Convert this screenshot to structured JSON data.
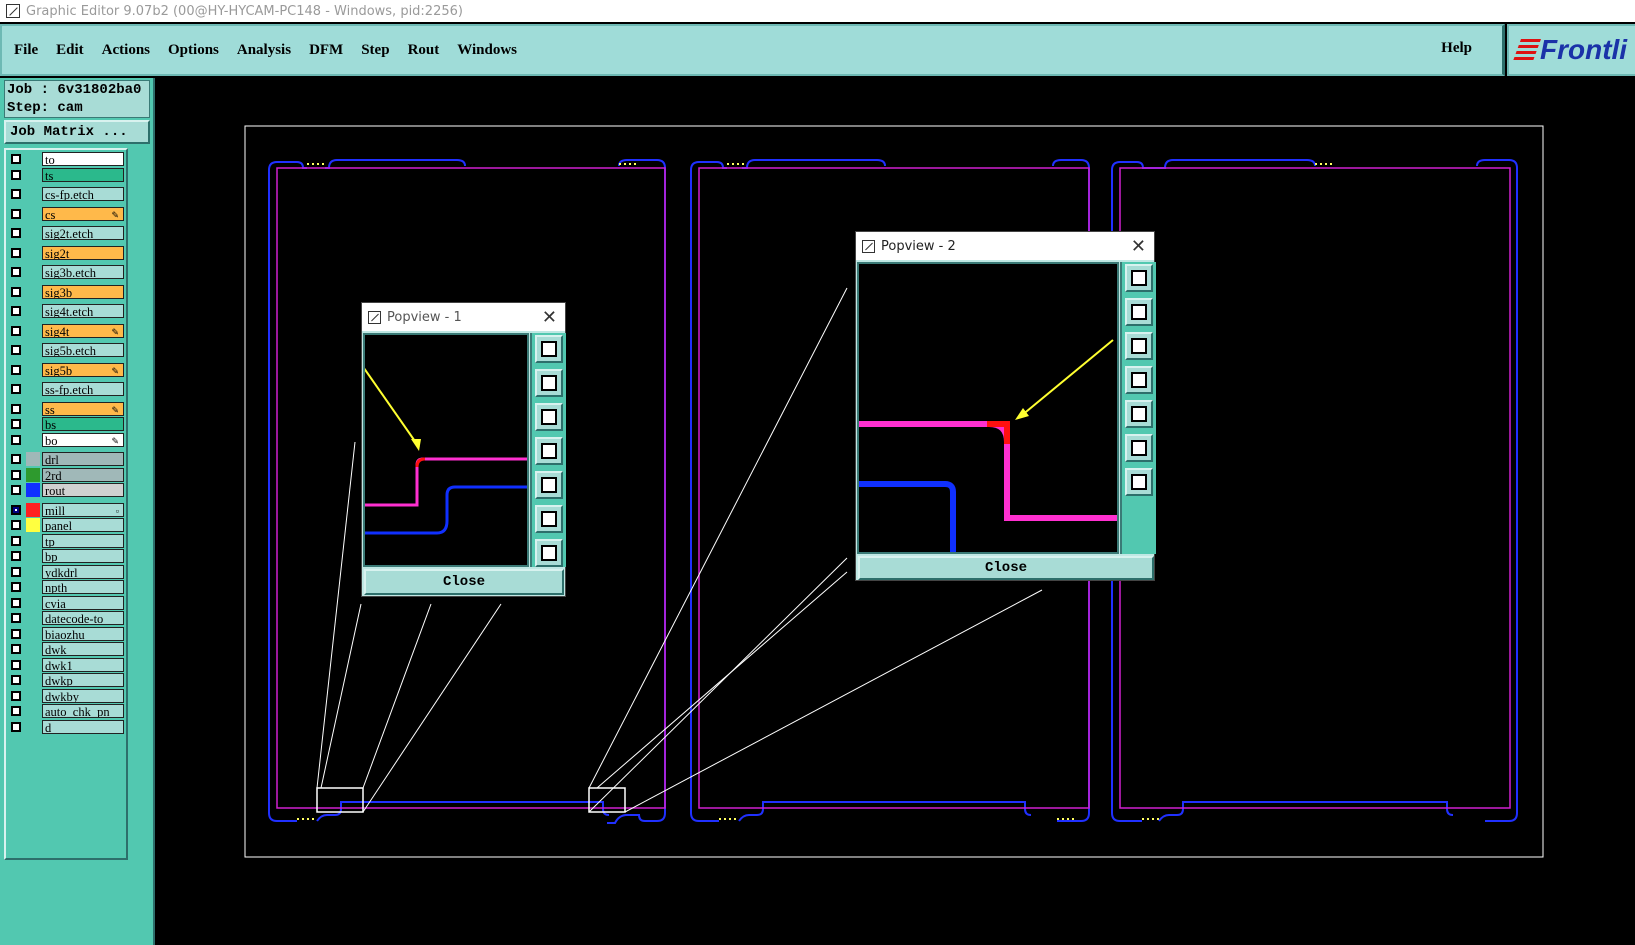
{
  "window": {
    "title": "Graphic Editor 9.07b2 (00@HY-HYCAM-PC148 - Windows, pid:2256)"
  },
  "menu": {
    "items": [
      "File",
      "Edit",
      "Actions",
      "Options",
      "Analysis",
      "DFM",
      "Step",
      "Rout",
      "Windows"
    ],
    "help": "Help",
    "logo": "Frontli"
  },
  "job": {
    "job_line": "Job : 6v31802ba0",
    "step_line": "Step: cam",
    "matrix_button": "Job Matrix ..."
  },
  "layers": [
    {
      "name": "to",
      "color": "#ffffff",
      "checked": false,
      "flag": ""
    },
    {
      "name": "ts",
      "color": "#2bb98c",
      "checked": false,
      "flag": ""
    },
    {
      "name": "cs-fp.etch",
      "color": "#a8dcd6",
      "checked": false,
      "flag": ""
    },
    {
      "name": "cs",
      "color": "#ffb94a",
      "checked": false,
      "flag": "✎"
    },
    {
      "name": "sig2t.etch",
      "color": "#a8dcd6",
      "checked": false,
      "flag": ""
    },
    {
      "name": "sig2t",
      "color": "#ffb94a",
      "checked": false,
      "flag": ""
    },
    {
      "name": "sig3b.etch",
      "color": "#a8dcd6",
      "checked": false,
      "flag": ""
    },
    {
      "name": "sig3b",
      "color": "#ffb94a",
      "checked": false,
      "flag": ""
    },
    {
      "name": "sig4t.etch",
      "color": "#a8dcd6",
      "checked": false,
      "flag": ""
    },
    {
      "name": "sig4t",
      "color": "#ffb94a",
      "checked": false,
      "flag": "✎"
    },
    {
      "name": "sig5b.etch",
      "color": "#a8dcd6",
      "checked": false,
      "flag": ""
    },
    {
      "name": "sig5b",
      "color": "#ffb94a",
      "checked": false,
      "flag": "✎"
    },
    {
      "name": "ss-fp.etch",
      "color": "#a8dcd6",
      "checked": false,
      "flag": ""
    },
    {
      "name": "ss",
      "color": "#ffb94a",
      "checked": false,
      "flag": "✎"
    },
    {
      "name": "bs",
      "color": "#2bb98c",
      "checked": false,
      "flag": ""
    },
    {
      "name": "bo",
      "color": "#ffffff",
      "checked": false,
      "flag": "✎"
    },
    {
      "name": "drl",
      "color": "#a0b8b8",
      "checked": false,
      "flag": ""
    },
    {
      "name": "2rd",
      "color": "#a0b8b8",
      "checked": false,
      "flag": ""
    },
    {
      "name": "rout",
      "color": "#d0d0d0",
      "checked": false,
      "flag": ""
    },
    {
      "name": "mill",
      "color": "#a8dcd6",
      "checked": true,
      "flag": "▫"
    },
    {
      "name": "panel",
      "color": "#a8dcd6",
      "checked": false,
      "flag": ""
    },
    {
      "name": "tp",
      "color": "#a8dcd6",
      "checked": false,
      "flag": ""
    },
    {
      "name": "bp",
      "color": "#a8dcd6",
      "checked": false,
      "flag": ""
    },
    {
      "name": "ydkdrl",
      "color": "#a8dcd6",
      "checked": false,
      "flag": ""
    },
    {
      "name": "npth",
      "color": "#a8dcd6",
      "checked": false,
      "flag": ""
    },
    {
      "name": "cvia",
      "color": "#a8dcd6",
      "checked": false,
      "flag": ""
    },
    {
      "name": "datecode-to",
      "color": "#a8dcd6",
      "checked": false,
      "flag": ""
    },
    {
      "name": "biaozhu",
      "color": "#a8dcd6",
      "checked": false,
      "flag": ""
    },
    {
      "name": "dwk",
      "color": "#a8dcd6",
      "checked": false,
      "flag": ""
    },
    {
      "name": "dwk1",
      "color": "#a8dcd6",
      "checked": false,
      "flag": ""
    },
    {
      "name": "dwkp",
      "color": "#a8dcd6",
      "checked": false,
      "flag": ""
    },
    {
      "name": "dwkby",
      "color": "#a8dcd6",
      "checked": false,
      "flag": ""
    },
    {
      "name": "auto_chk_pn",
      "color": "#a8dcd6",
      "checked": false,
      "flag": ""
    },
    {
      "name": "d",
      "color": "#a8dcd6",
      "checked": false,
      "flag": ""
    }
  ],
  "layer_swatches": {
    "drl": "#a0b8b8",
    "2rd": "#2e9a2e",
    "rout": "#1030ff",
    "mill": "#ff2020",
    "panel": "#ffff40"
  },
  "popview1": {
    "title": "Popview - 1",
    "close": "Close"
  },
  "popview2": {
    "title": "Popview - 2",
    "close": "Close"
  },
  "popview_tools": [
    "zoom-home-icon",
    "pan-up-icon",
    "pan-down-icon",
    "pan-left-icon",
    "pan-right-icon",
    "zoom-out-icon",
    "zoom-in-icon"
  ],
  "colors": {
    "accent": "#9fdcd8",
    "panel": "#52c8b0",
    "board_outline": "#2030ff",
    "profile": "#d020d0",
    "arrow": "#ffff30"
  }
}
